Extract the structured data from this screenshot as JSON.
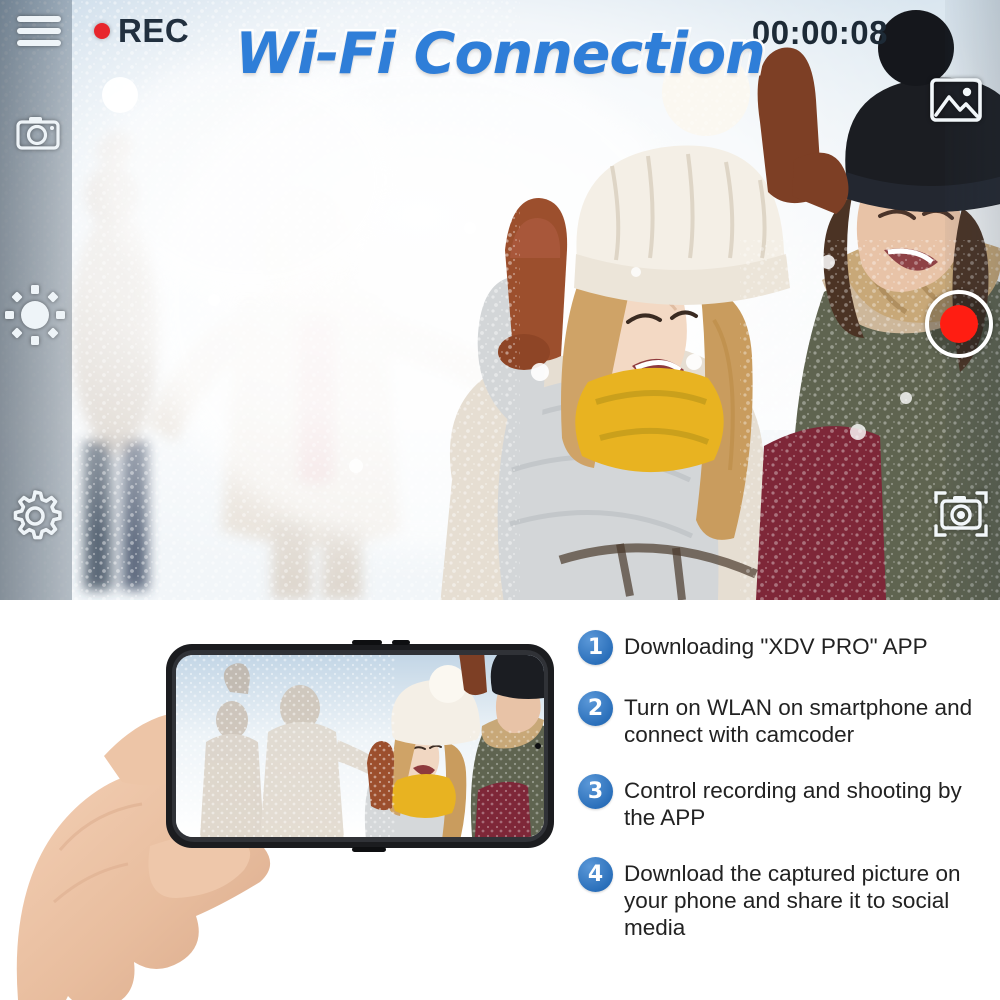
{
  "viewfinder": {
    "rec_label": "REC",
    "timer": "00:00:08",
    "title": "Wi-Fi Connection",
    "icons": {
      "menu": "menu-icon",
      "camera": "camera-icon",
      "brightness": "brightness-sun-icon",
      "settings": "gear-icon",
      "gallery": "gallery-image-icon",
      "snapshot": "camera-shutter-icon",
      "record": "record-button"
    },
    "scene": "people throwing snow in bright winter landscape"
  },
  "bottom": {
    "phone_caption": "hand holding smartphone showing winter snow scene in landscape",
    "steps": [
      {
        "num": "1",
        "text": "Downloading \"XDV PRO\" APP"
      },
      {
        "num": "2",
        "text": "Turn on WLAN on smartphone and connect with camcoder"
      },
      {
        "num": "3",
        "text": "Control recording and shooting by the APP"
      },
      {
        "num": "4",
        "text": "Download the captured picture on your phone and share it to social media"
      }
    ]
  },
  "colors": {
    "title_blue": "#2f7ed8",
    "step_circle_blue": "#2a6fba",
    "rec_red": "#e8262c",
    "record_red": "#ff1d12",
    "rec_text": "#22303f",
    "body_text": "#222222",
    "background": "#ffffff"
  }
}
